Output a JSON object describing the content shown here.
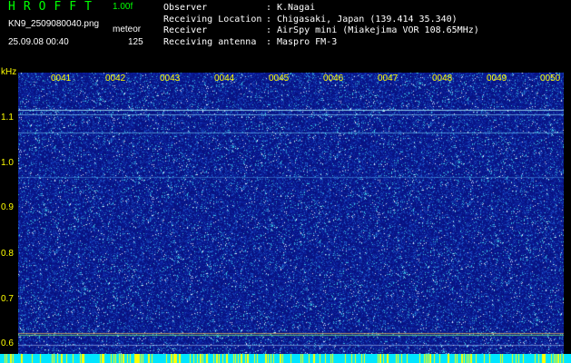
{
  "header": {
    "app_title": "HROFFT",
    "version": "1.00f",
    "filename": "KN9_2509080040.png",
    "mode": "meteor",
    "datetime": "25.09.08 00:40",
    "count": "125",
    "metadata": [
      {
        "key": "Observer",
        "value": "K.Nagai"
      },
      {
        "key": "Receiving Location",
        "value": "Chigasaki, Japan (139.414 35.340)"
      },
      {
        "key": "Receiver",
        "value": "AirSpy mini (Miakejima VOR 108.65MHz)"
      },
      {
        "key": "Receiving antenna",
        "value": "Maspro FM-3"
      }
    ]
  },
  "spectrogram": {
    "unit": "kHz",
    "y_ticks": [
      "1.1",
      "1.0",
      "0.9",
      "0.8",
      "0.7",
      "0.6"
    ],
    "x_labels": [
      "0041",
      "0042",
      "0043",
      "0044",
      "0045",
      "0046",
      "0047",
      "0048",
      "0049",
      "0050"
    ],
    "colors": {
      "background": "#0a1a8a",
      "label": "#ffff00",
      "strip": "#00e5ff"
    }
  }
}
